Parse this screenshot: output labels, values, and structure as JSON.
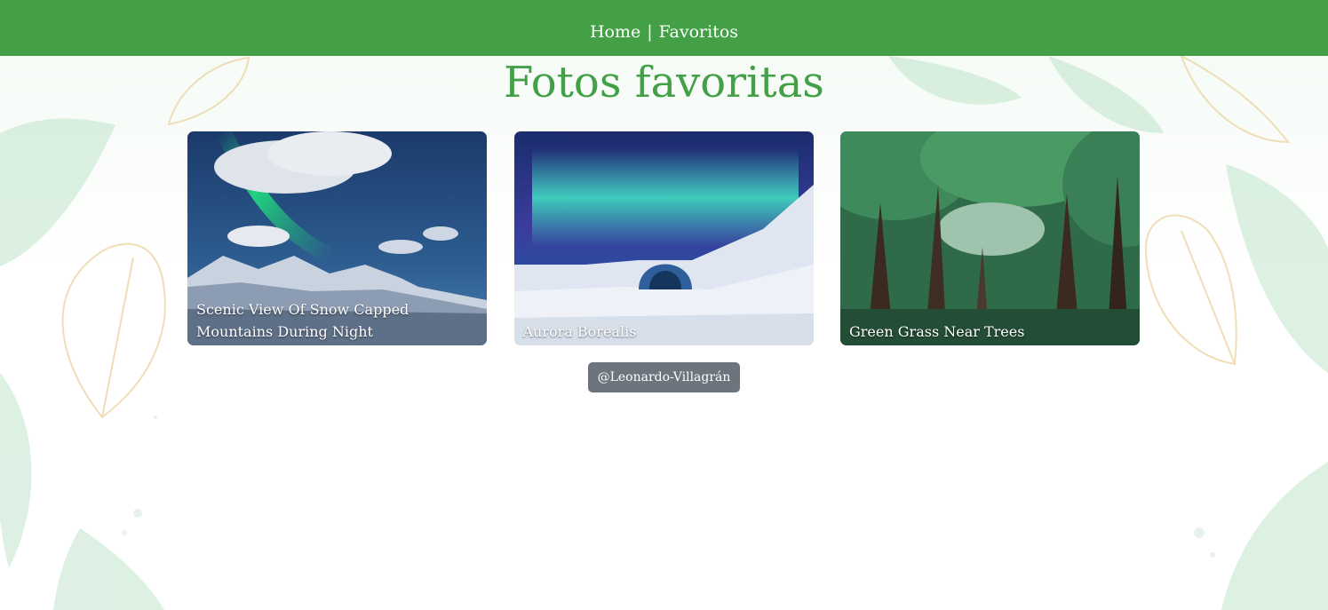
{
  "nav": {
    "home_label": "Home",
    "separator": "|",
    "favorites_label": "Favoritos"
  },
  "main": {
    "title": "Fotos favoritas",
    "photos": [
      {
        "caption": "Scenic View Of Snow Capped Mountains During Night"
      },
      {
        "caption": "Aurora Borealis"
      },
      {
        "caption": "Green Grass Near Trees"
      }
    ],
    "credit": "@Leonardo-Villagrán"
  },
  "colors": {
    "accent": "#43a047",
    "badge": "#6c757d"
  }
}
